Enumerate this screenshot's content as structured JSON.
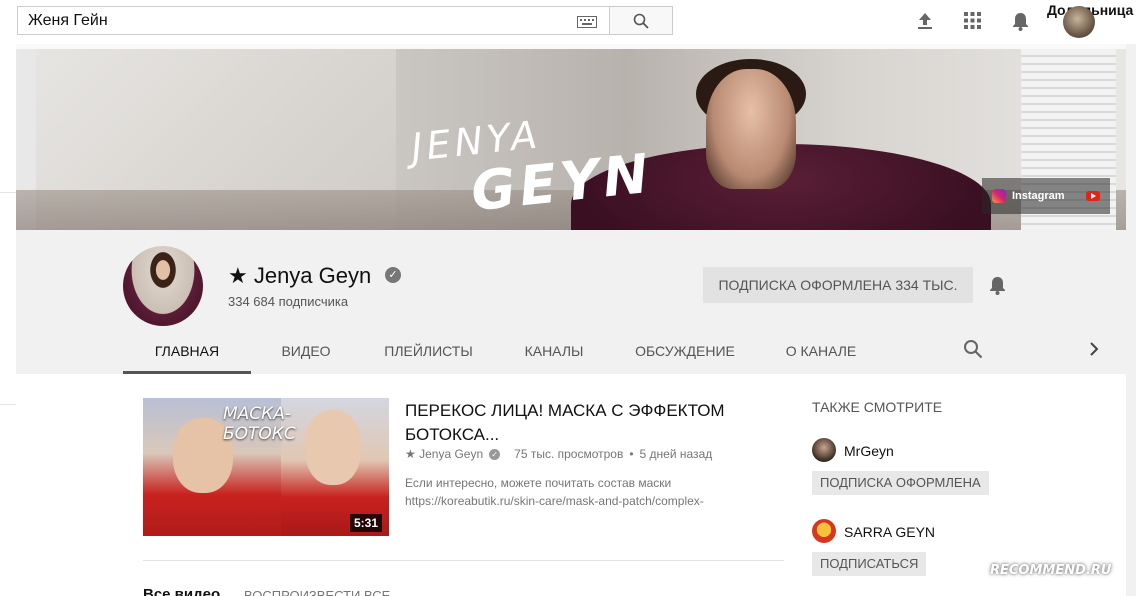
{
  "topbar": {
    "search_value": "Женя Гейн",
    "search_placeholder": "",
    "user_name": "Дoдельница"
  },
  "banner": {
    "title_line1": "JENYA",
    "title_line2": "GEYN",
    "link_label": "Instagram"
  },
  "channel": {
    "name": "★ Jenya Geyn",
    "subscribers": "334 684 подписчика",
    "subscribe_button": "ПОДПИСКА ОФОРМЛЕНА  334 ТЫС."
  },
  "tabs": [
    {
      "label": "ГЛАВНАЯ",
      "active": true
    },
    {
      "label": "ВИДЕО"
    },
    {
      "label": "ПЛЕЙЛИСТЫ"
    },
    {
      "label": "КАНАЛЫ"
    },
    {
      "label": "ОБСУЖДЕНИЕ"
    },
    {
      "label": "О КАНАЛЕ"
    }
  ],
  "featured": {
    "thumb_text": "МАСКА-\nБОТОКС",
    "duration": "5:31",
    "title": "ПЕРЕКОС ЛИЦА! МАСКА С ЭФФЕКТОМ БОТОКСА...",
    "channel": "★ Jenya Geyn",
    "views": "75 тыс. просмотров",
    "age": "5 дней назад",
    "desc_line1": "Если интересно, можете почитать состав маски",
    "desc_line2": "https://koreabutik.ru/skin-care/mask-and-patch/complex-"
  },
  "sections": {
    "all_videos": "Все видео",
    "play_all": "ВОСПРОИЗВЕСТИ ВСЕ"
  },
  "related": {
    "title": "ТАКЖЕ СМОТРИТЕ",
    "items": [
      {
        "name": "MrGeyn",
        "button": "ПОДПИСКА ОФОРМЛЕНА"
      },
      {
        "name": "SARRA GEYN",
        "button": "ПОДПИСАТЬСЯ"
      }
    ]
  },
  "watermark": "RECOMMEND.RU",
  "colors": {
    "accent_red": "#e62117",
    "subscribed_bg": "#e2e2e2",
    "page_bg": "#f9f9f9"
  }
}
